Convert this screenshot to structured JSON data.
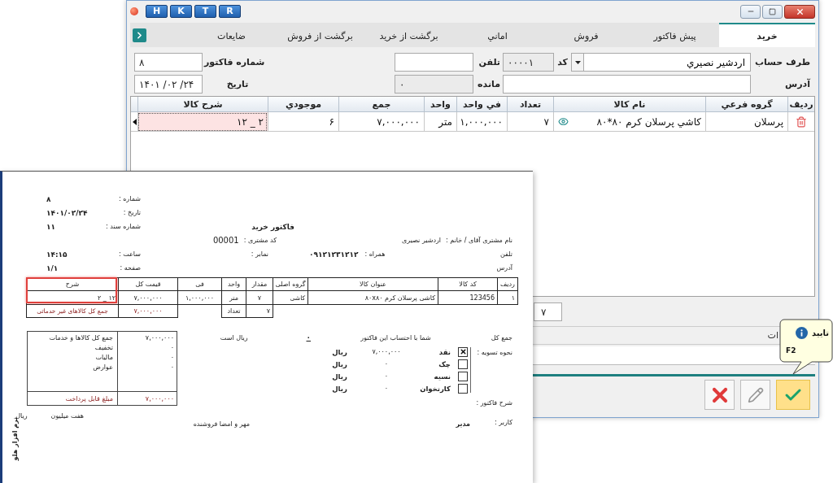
{
  "window": {
    "toolbar_buttons": [
      "R",
      "T",
      "K",
      "H"
    ]
  },
  "tabs": [
    {
      "label": "خرید",
      "selected": true
    },
    {
      "label": "پیش فاکتور",
      "selected": false
    },
    {
      "label": "فروش",
      "selected": false
    },
    {
      "label": "اماني",
      "selected": false
    },
    {
      "label": "برگشت از خرید",
      "selected": false
    },
    {
      "label": "برگشت از فروش",
      "selected": false
    },
    {
      "label": "ضایعات",
      "selected": false
    }
  ],
  "form": {
    "account": {
      "label": "طرف حساب",
      "value": "اردشیر نصیري"
    },
    "code": {
      "label": "کد",
      "value": "۰۰۰۰۱"
    },
    "phone": {
      "label": "تلفن"
    },
    "invoice_number": {
      "label": "شماره فاکتور",
      "value": "۸"
    },
    "address": {
      "label": "آدرس"
    },
    "balance": {
      "label": "مانده",
      "value": "۰"
    },
    "date": {
      "label": "تاریخ",
      "value": "۱۴۰۱ /۰۲ /۲۴"
    }
  },
  "grid": {
    "columns": [
      "ردیف",
      "گروه فرعي",
      "نام کالا",
      "تعداد",
      "في واحد",
      "واحد",
      "جمع",
      "موجودي",
      "شرح کالا"
    ],
    "rows": [
      {
        "selected": true,
        "cells": [
          "",
          "پرسلان",
          "کاشي پرسلان کرم ۸۰*۸۰",
          "۷",
          "۱,۰۰۰,۰۰۰",
          "متر",
          "۷,۰۰۰,۰۰۰",
          "۶",
          "۲ _ ۱۲"
        ]
      }
    ]
  },
  "bottom": {
    "quantity_total": "۷",
    "notes_label": "ات"
  },
  "actions": [
    {
      "kind": "confirm",
      "hovered": true
    },
    {
      "kind": "edit",
      "hovered": false
    },
    {
      "kind": "cancel",
      "hovered": false
    }
  ],
  "tooltip": {
    "title": "تایید",
    "shortcut": "F2"
  },
  "invoice": {
    "meta": [
      {
        "label": "شماره :",
        "value": "۸"
      },
      {
        "label": "تاریخ :",
        "value": "۱۴۰۱/۰۲/۲۴"
      },
      {
        "label": "شماره سند :",
        "value": "۱۱"
      }
    ],
    "meta_time": [
      {
        "label": "ساعت :",
        "value": "۱۴:۱۵"
      },
      {
        "label": "صفحه :",
        "value": "۱/۱"
      }
    ],
    "title": "فاکتور خرید",
    "customer_code": {
      "label": "کد مشتری :",
      "value": "00001"
    },
    "customer": {
      "label": "نام مشتری آقای / خانم :",
      "value": "اردشیر نصیری"
    },
    "phone_label": "تلفن",
    "mobile": {
      "label": "همراه :",
      "value": "۰۹۱۲۱۲۳۱۲۱۲"
    },
    "fax_label": "نمابر :",
    "address_label": "آدرس",
    "table": {
      "columns": [
        {
          "label": "ردیف",
          "highlighted": false
        },
        {
          "label": "کد کالا",
          "highlighted": false
        },
        {
          "label": "عنوان کالا",
          "highlighted": false
        },
        {
          "label": "گروه اصلی",
          "highlighted": false
        },
        {
          "label": "مقدار",
          "highlighted": false
        },
        {
          "label": "واحد",
          "highlighted": false
        },
        {
          "label": "فی",
          "highlighted": false
        },
        {
          "label": "قیمت کل",
          "highlighted": false
        },
        {
          "label": "شرح",
          "highlighted": true
        }
      ],
      "rows": [
        [
          "۱",
          "123456",
          "کاشی پرسلان کرم ۸۰x۸۰",
          "کاشی",
          "۷",
          "متر",
          "۱,۰۰۰,۰۰۰",
          "۷,۰۰۰,۰۰۰",
          "۱۲ _ ۲"
        ]
      ]
    },
    "summary": {
      "goods_total_label": "جمع کل کالاهای غیر خدماتی",
      "goods_total": "۷,۰۰۰,۰۰۰",
      "count_label": "تعداد",
      "count": "۷"
    },
    "grand_total_label": "جمع کل",
    "balance_text": "شما با احتساب این فاکتور",
    "balance_value": "۰",
    "balance_suffix": "ریال است",
    "settlement_label": "نحوه تسویه :",
    "settlement": [
      {
        "label": "نقد",
        "checked": true,
        "amount": "۷,۰۰۰,۰۰۰",
        "currency": "ریال"
      },
      {
        "label": "چک",
        "checked": false,
        "amount": "۰",
        "currency": "ریال"
      },
      {
        "label": "نسیه",
        "checked": false,
        "amount": "۰",
        "currency": "ریال"
      },
      {
        "label": "کارتخوان",
        "checked": false,
        "amount": "۰",
        "currency": "ریال"
      }
    ],
    "totals": [
      {
        "label": "جمع کل کالاها و خدمات",
        "value": "۷,۰۰۰,۰۰۰"
      },
      {
        "label": "تخفیف",
        "value": "۰"
      },
      {
        "label": "مالیات",
        "value": "۰"
      },
      {
        "label": "عوارض",
        "value": "۰"
      }
    ],
    "payable": {
      "label": "مبلغ قابل پرداخت",
      "value": "۷,۰۰۰,۰۰۰"
    },
    "amount_words": "هفت میلیون",
    "amount_currency": "ریال",
    "notes_label": "شرح فاکتور :",
    "user": {
      "label": "کاربر :",
      "value": "مدیر"
    },
    "signature": "مهر و امضا فروشنده",
    "side_text": "نرم افزار هلو"
  }
}
